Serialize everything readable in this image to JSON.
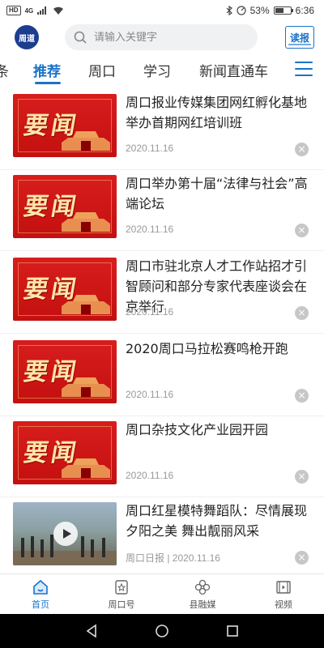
{
  "status_bar": {
    "hd": "HD",
    "network": "4G",
    "battery_percent": "53%",
    "battery_level": 0.53,
    "time": "6:36"
  },
  "header": {
    "logo_text": "周道",
    "search_placeholder": "请输入关键字",
    "read_paper_label": "读报"
  },
  "tabs": [
    {
      "label": "条",
      "active": false
    },
    {
      "label": "推荐",
      "active": true
    },
    {
      "label": "周口",
      "active": false
    },
    {
      "label": "学习",
      "active": false
    },
    {
      "label": "新闻直通车",
      "active": false
    }
  ],
  "feed": {
    "thumb_text": "要闻",
    "items": [
      {
        "title": "周口报业传媒集团网红孵化基地举办首期网红培训班",
        "meta": "2020.11.16",
        "thumb": "red"
      },
      {
        "title": "周口举办第十届“法律与社会”高端论坛",
        "meta": "2020.11.16",
        "thumb": "red"
      },
      {
        "title": "周口市驻北京人才工作站招才引智顾问和部分专家代表座谈会在京举行",
        "meta": "2020.11.16",
        "thumb": "red"
      },
      {
        "title": "2020周口马拉松赛鸣枪开跑",
        "meta": "2020.11.16",
        "thumb": "red"
      },
      {
        "title": "周口杂技文化产业园开园",
        "meta": "2020.11.16",
        "thumb": "red"
      },
      {
        "title": "周口红星模特舞蹈队：尽情展现夕阳之美 舞出靓丽风采",
        "meta": "周口日报 | 2020.11.16",
        "thumb": "video"
      }
    ]
  },
  "bottom_nav": [
    {
      "label": "首页",
      "icon": "home-icon",
      "active": true
    },
    {
      "label": "周口号",
      "icon": "star-badge-icon",
      "active": false
    },
    {
      "label": "县融媒",
      "icon": "flower-icon",
      "active": false
    },
    {
      "label": "视频",
      "icon": "film-icon",
      "active": false
    }
  ],
  "colors": {
    "accent": "#1a73c8",
    "thumb_red": "#d81d1d"
  }
}
